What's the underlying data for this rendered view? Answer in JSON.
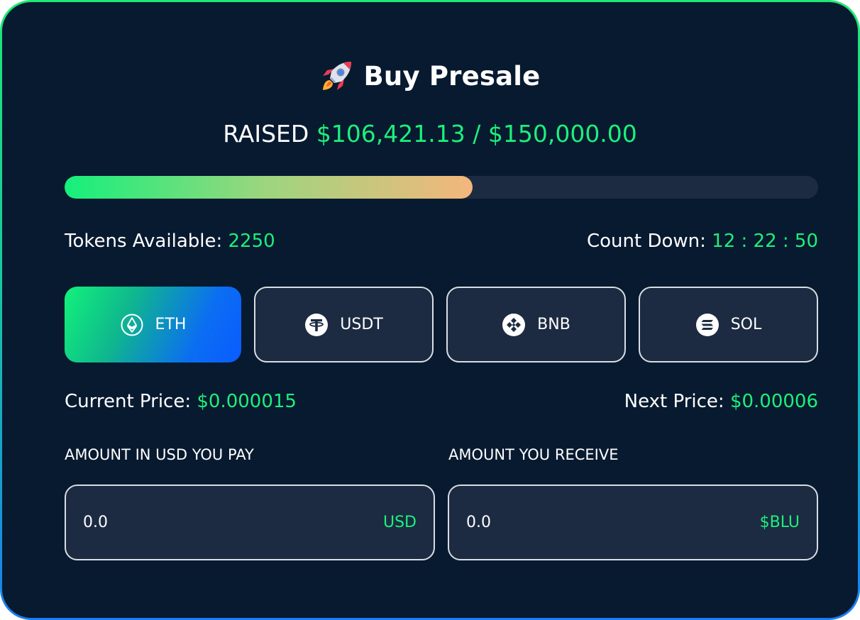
{
  "header": {
    "title": "Buy Presale",
    "icon": "rocket-icon"
  },
  "raised": {
    "label": "RAISED",
    "amount": "$106,421.13 / $150,000.00",
    "progress_fraction": 0.541
  },
  "stats": {
    "tokens_label": "Tokens Available:",
    "tokens_value": "2250",
    "countdown_label": "Count Down:",
    "countdown_value": "12 : 22 : 50"
  },
  "currencies": [
    {
      "label": "ETH",
      "icon": "eth-icon",
      "selected": true
    },
    {
      "label": "USDT",
      "icon": "usdt-icon",
      "selected": false
    },
    {
      "label": "BNB",
      "icon": "bnb-icon",
      "selected": false
    },
    {
      "label": "SOL",
      "icon": "sol-icon",
      "selected": false
    }
  ],
  "prices": {
    "current_label": "Current Price:",
    "current_value": "$0.000015",
    "next_label": "Next Price:",
    "next_value": "$0.00006"
  },
  "pay": {
    "label": "AMOUNT IN USD YOU PAY",
    "value": "0.0",
    "unit": "USD"
  },
  "receive": {
    "label": "AMOUNT YOU RECEIVE",
    "value": "0.0",
    "unit": "$BLU"
  },
  "colors": {
    "background": "#081a30",
    "accent": "#1cf07b",
    "panel": "#1c2b42"
  }
}
